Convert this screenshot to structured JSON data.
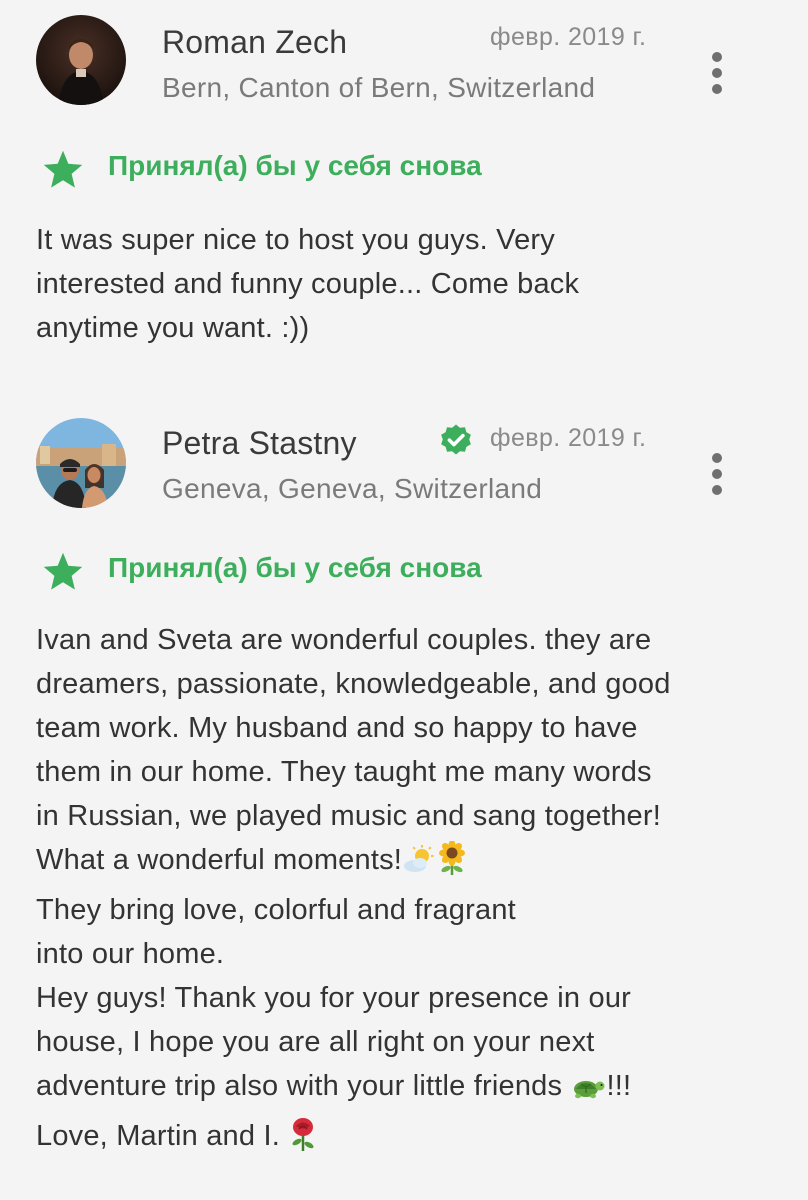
{
  "reviews": [
    {
      "author": "Roman Zech",
      "location": "Bern, Canton of Bern, Switzerland",
      "date": "февр. 2019 г.",
      "verified": false,
      "recommendation": "Принял(а) бы у себя снова",
      "text_lines": [
        "It was super nice to host you guys. Very",
        "interested and funny couple... Come back",
        "anytime you want. :))"
      ]
    },
    {
      "author": "Petra Stastny",
      "location": "Geneva, Geneva, Switzerland",
      "date": "февр. 2019 г.",
      "verified": true,
      "recommendation": "Принял(а) бы у себя снова",
      "text_lines": [
        "Ivan and Sveta are wonderful couples. they are",
        "dreamers, passionate, knowledgeable, and good",
        "team work. My husband and so happy to have",
        "them in our home. They taught me many words",
        "in Russian, we played music and sang together!",
        "What a wonderful moments!",
        "They bring love, colorful and fragrant",
        "into our home.",
        "",
        "Hey guys! Thank you for your presence in our",
        "house, I hope you are all right on your next",
        "adventure trip also with your little friends",
        "Love, Martin and I."
      ],
      "line_suffixes": {
        "5": "!!!"
      }
    }
  ],
  "icons": {
    "menu": "more-vertical-icon",
    "recommendation": "star-icon",
    "verified": "verified-check-icon",
    "emoji_sun_cloud": "sun-behind-cloud-icon",
    "emoji_sunflower": "sunflower-icon",
    "emoji_turtle": "turtle-icon",
    "emoji_rose": "rose-icon"
  },
  "colors": {
    "accent_green": "#3dae5c",
    "background": "#f4f4f4",
    "text": "#333333",
    "muted": "#7a7a7a"
  }
}
